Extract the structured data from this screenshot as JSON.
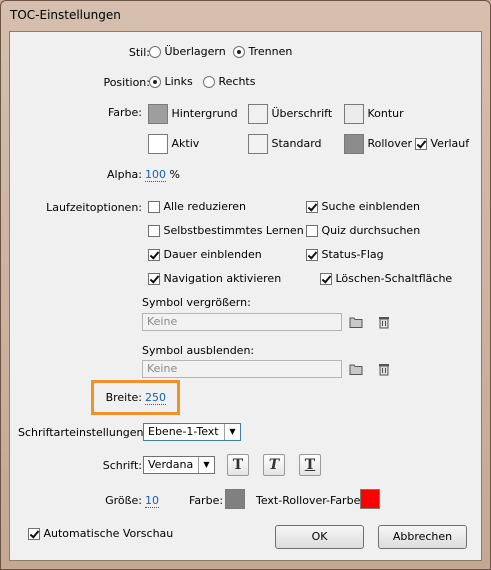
{
  "window": {
    "title": "TOC-Einstellungen"
  },
  "stil": {
    "label": "Stil:",
    "options": [
      "Überlagern",
      "Trennen"
    ],
    "selected": "Trennen"
  },
  "position": {
    "label": "Position:",
    "options": [
      "Links",
      "Rechts"
    ],
    "selected": "Links"
  },
  "farbe": {
    "label": "Farbe:",
    "hintergrund": {
      "label": "Hintergrund",
      "color": "#9e9e9e"
    },
    "ueberschrift": {
      "label": "Überschrift",
      "color": "#f0f0f0"
    },
    "kontur": {
      "label": "Kontur",
      "color": "#ececec"
    },
    "aktiv": {
      "label": "Aktiv",
      "color": "#ffffff"
    },
    "standard": {
      "label": "Standard",
      "color": "#f2f2f2"
    },
    "rollover": {
      "label": "Rollover",
      "color": "#8c8c8c"
    },
    "verlauf": {
      "label": "Verlauf",
      "checked": true
    }
  },
  "alpha": {
    "label": "Alpha:",
    "value": "100",
    "unit": "%"
  },
  "laufzeit": {
    "label": "Laufzeitoptionen:",
    "alle_reduzieren": {
      "label": "Alle reduzieren",
      "checked": false
    },
    "suche_einblenden": {
      "label": "Suche einblenden",
      "checked": true
    },
    "selbstbestimmtes_lernen": {
      "label": "Selbstbestimmtes Lernen",
      "checked": false
    },
    "quiz_durchsuchen": {
      "label": "Quiz durchsuchen",
      "checked": false
    },
    "dauer_einblenden": {
      "label": "Dauer einblenden",
      "checked": true
    },
    "status_flag": {
      "label": "Status-Flag",
      "checked": true
    },
    "navigation_aktivieren": {
      "label": "Navigation aktivieren",
      "checked": true
    },
    "loeschen_schaltflaeche": {
      "label": "Löschen-Schaltfläche",
      "checked": true
    }
  },
  "symbol_vergroessern": {
    "label": "Symbol vergrößern:",
    "placeholder": "Keine"
  },
  "symbol_ausblenden": {
    "label": "Symbol ausblenden:",
    "placeholder": "Keine"
  },
  "breite": {
    "label": "Breite:",
    "value": "250"
  },
  "schriftart": {
    "label": "Schriftarteinstellungen:",
    "value": "Ebene-1-Text"
  },
  "schrift": {
    "label": "Schrift:",
    "value": "Verdana"
  },
  "groesse": {
    "label": "Größe:",
    "value": "10"
  },
  "schrift_farbe": {
    "label": "Farbe:",
    "color": "#808080"
  },
  "text_rollover": {
    "label": "Text-Rollover-Farbe:",
    "color": "#ff0000"
  },
  "auto_vorschau": {
    "label": "Automatische Vorschau",
    "checked": true
  },
  "buttons": {
    "ok": "OK",
    "cancel": "Abbrechen"
  },
  "icons": {
    "folder": "folder-icon",
    "trash": "trash-icon",
    "bold": "bold-text-icon",
    "italic": "italic-text-icon",
    "underline": "underline-text-icon"
  }
}
